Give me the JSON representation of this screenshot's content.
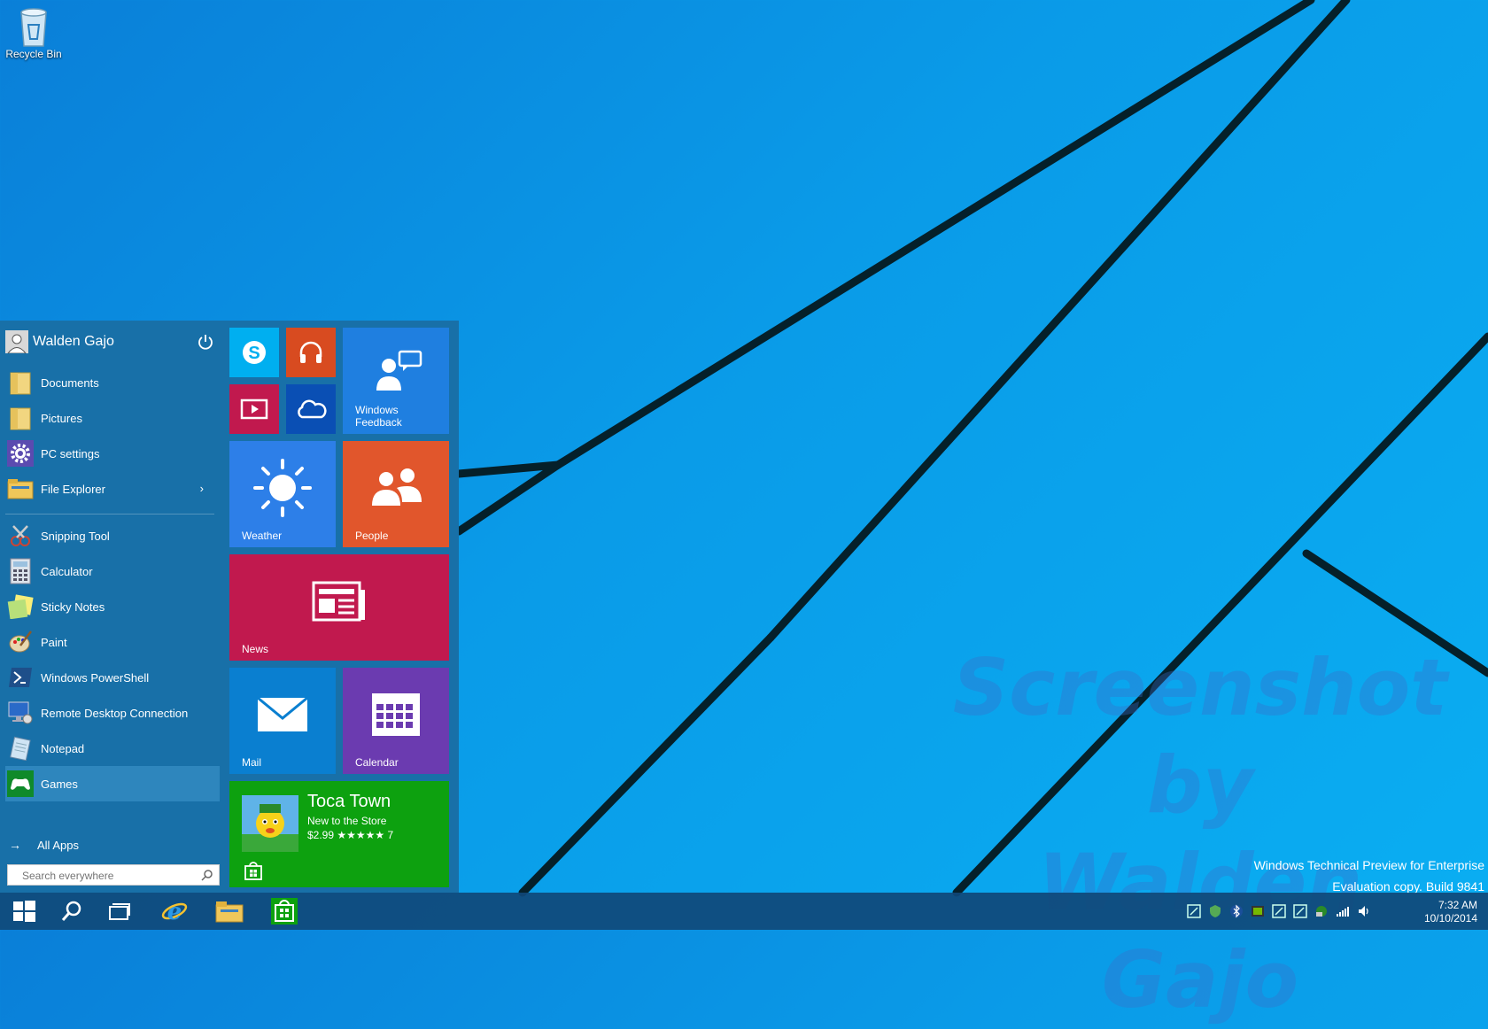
{
  "desktop": {
    "recycle_bin_label": "Recycle Bin",
    "watermark_line1": "Screenshot by",
    "watermark_line2": "Walden Gajo",
    "eval_line1": "Windows Technical Preview for Enterprise",
    "eval_line2": "Evaluation copy. Build 9841"
  },
  "start_menu": {
    "user_name": "Walden Gajo",
    "items": [
      {
        "label": "Documents",
        "icon": "folder-icon"
      },
      {
        "label": "Pictures",
        "icon": "folder-icon"
      },
      {
        "label": "PC settings",
        "icon": "gear-icon"
      },
      {
        "label": "File Explorer",
        "icon": "file-explorer-icon"
      },
      {
        "label": "Snipping Tool",
        "icon": "scissors-icon"
      },
      {
        "label": "Calculator",
        "icon": "calculator-icon"
      },
      {
        "label": "Sticky Notes",
        "icon": "sticky-note-icon"
      },
      {
        "label": "Paint",
        "icon": "paint-palette-icon"
      },
      {
        "label": "Windows PowerShell",
        "icon": "powershell-icon"
      },
      {
        "label": "Remote Desktop Connection",
        "icon": "remote-desktop-icon"
      },
      {
        "label": "Notepad",
        "icon": "notepad-icon"
      },
      {
        "label": "Games",
        "icon": "gamepad-icon"
      }
    ],
    "all_apps_label": "All Apps",
    "search_placeholder": "Search everywhere"
  },
  "tiles": {
    "windows_feedback": "Windows Feedback",
    "weather": "Weather",
    "people": "People",
    "news": "News",
    "mail": "Mail",
    "calendar": "Calendar",
    "store_title": "Toca Town",
    "store_sub": "New to the Store",
    "store_price": "$2.99 ★★★★★ 7"
  },
  "colors": {
    "skype": "#00aff0",
    "music": "#d84b20",
    "video": "#c1194e",
    "onedrive": "#0a4fb4",
    "feedback": "#1f7fe0",
    "weather": "#2d7fe8",
    "people": "#e1562c",
    "news": "#c1194e",
    "mail": "#0a7fd0",
    "calendar": "#6b3bb0",
    "store": "#0da10f"
  },
  "clock": {
    "time": "7:32 AM",
    "date": "10/10/2014"
  }
}
